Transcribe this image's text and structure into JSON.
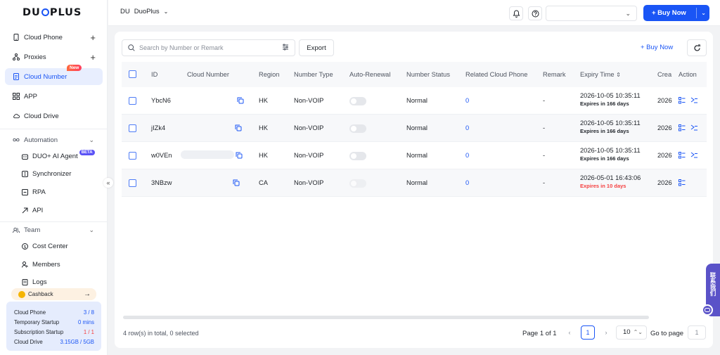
{
  "brand": {
    "logo_text_a": "DU",
    "logo_text_b": "PLUS"
  },
  "sidebar": {
    "nav": [
      {
        "label": "Cloud Phone",
        "icon": "phone-icon",
        "has_add": true
      },
      {
        "label": "Proxies",
        "icon": "proxy-icon",
        "has_add": true
      },
      {
        "label": "Cloud Number",
        "icon": "document-icon",
        "badge": "New",
        "active": true
      },
      {
        "label": "APP",
        "icon": "grid-icon"
      },
      {
        "label": "Cloud Drive",
        "icon": "cloud-icon"
      }
    ],
    "automation": {
      "label": "Automation",
      "items": [
        {
          "label": "DUO+ AI Agent",
          "badge": "BETA"
        },
        {
          "label": "Synchronizer"
        },
        {
          "label": "RPA"
        },
        {
          "label": "API"
        }
      ]
    },
    "team": {
      "label": "Team",
      "items": [
        {
          "label": "Cost Center"
        },
        {
          "label": "Members"
        },
        {
          "label": "Logs"
        }
      ]
    },
    "cashback": {
      "label": "Cashback",
      "arrow": "→"
    },
    "usage": [
      {
        "label": "Cloud Phone",
        "value": "3 / 8",
        "color": "#1a55f5"
      },
      {
        "label": "Temporary Startup",
        "value": "0 mins",
        "color": "#1a55f5"
      },
      {
        "label": "Subscription Startup",
        "value": "1 / 1",
        "color": "#f53f3f"
      },
      {
        "label": "Cloud Drive",
        "value": "3.15GB / 5GB",
        "color": "#1a55f5"
      }
    ]
  },
  "topbar": {
    "workspace_abbr": "DU",
    "workspace_name": "DuoPlus",
    "buy_now": "+ Buy Now"
  },
  "toolbar": {
    "search_placeholder": "Search by Number or Remark",
    "export": "Export",
    "buy_now": "+ Buy Now"
  },
  "table": {
    "columns": [
      "ID",
      "Cloud Number",
      "Region",
      "Number Type",
      "Auto-Renewal",
      "Number Status",
      "Related Cloud Phone",
      "Remark",
      "Expiry Time",
      "Crea",
      "Action"
    ],
    "rows": [
      {
        "id": "YbcN6",
        "region": "HK",
        "type": "Non-VOIP",
        "status": "Normal",
        "related": "0",
        "remark": "-",
        "expiry": "2026-10-05 10:35:11",
        "expires_in": "Expires in 166 days",
        "expires_warn": false,
        "created": "2026",
        "actions": 2
      },
      {
        "id": "jIZk4",
        "region": "HK",
        "type": "Non-VOIP",
        "status": "Normal",
        "related": "0",
        "remark": "-",
        "expiry": "2026-10-05 10:35:11",
        "expires_in": "Expires in 166 days",
        "expires_warn": false,
        "created": "2026",
        "actions": 2
      },
      {
        "id": "w0VEn",
        "region": "HK",
        "type": "Non-VOIP",
        "status": "Normal",
        "related": "0",
        "remark": "-",
        "expiry": "2026-10-05 10:35:11",
        "expires_in": "Expires in 166 days",
        "expires_warn": false,
        "created": "2026",
        "actions": 2
      },
      {
        "id": "3NBzw",
        "region": "CA",
        "type": "Non-VOIP",
        "status": "Normal",
        "related": "0",
        "remark": "-",
        "expiry": "2026-05-01 16:43:06",
        "expires_in": "Expires in 10 days",
        "expires_warn": true,
        "created": "2026",
        "actions": 1
      }
    ]
  },
  "footer": {
    "total": "4 row(s) in total, 0 selected",
    "page_info": "Page 1 of 1",
    "current_page": "1",
    "page_size": "10",
    "goto_label": "Go to page",
    "goto_value": "1"
  },
  "contact_widget": {
    "label": "联系我们"
  },
  "colors": {
    "primary": "#1a55f5",
    "danger": "#f53f3f",
    "accent_purple": "#5a52c8"
  }
}
